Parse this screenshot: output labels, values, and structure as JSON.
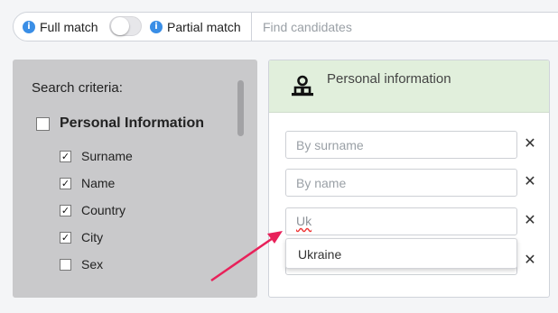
{
  "topbar": {
    "full_match_label": "Full match",
    "partial_match_label": "Partial match",
    "full_match_icon": "info-icon",
    "partial_match_icon": "info-icon",
    "toggle_state": "off",
    "search_placeholder": "Find candidates"
  },
  "criteria": {
    "title": "Search criteria:",
    "group": {
      "label": "Personal Information",
      "checked": false
    },
    "items": [
      {
        "label": "Surname",
        "checked": true
      },
      {
        "label": "Name",
        "checked": true
      },
      {
        "label": "Country",
        "checked": true
      },
      {
        "label": "City",
        "checked": true
      },
      {
        "label": "Sex",
        "checked": false
      }
    ]
  },
  "panel": {
    "icon": "person-icon",
    "title": "Personal information",
    "fields": [
      {
        "placeholder": "By surname",
        "value": ""
      },
      {
        "placeholder": "By name",
        "value": ""
      },
      {
        "placeholder": "",
        "value": "Uk"
      },
      {
        "placeholder": "",
        "value": ""
      }
    ],
    "suggestions": [
      "Ukraine"
    ],
    "close_icon": "close-icon",
    "close_glyph": "✕"
  },
  "check_glyph": "✓",
  "info_glyph": "i",
  "colors": {
    "accent": "#3a8ee6",
    "panel_header": "#e1efdc",
    "criteria_bg": "#c9c9cb",
    "arrow": "#e8215a"
  }
}
